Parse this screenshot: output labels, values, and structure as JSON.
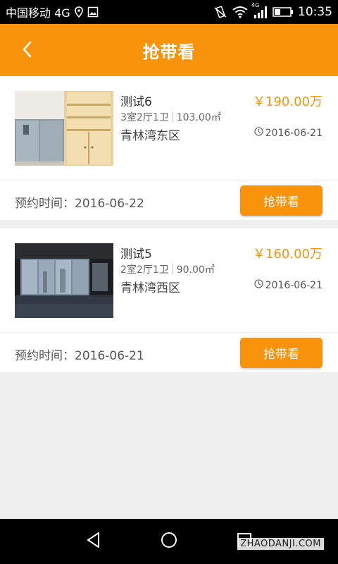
{
  "status_bar": {
    "carrier": "中国移动 4G",
    "network_badge": "4G",
    "time": "10:35"
  },
  "header": {
    "title": "抢带看",
    "back_icon": "chevron-left-icon"
  },
  "listings": [
    {
      "name": "测试6",
      "price": "￥190.00万",
      "layout": "3室2厅1卫",
      "area": "103.00㎡",
      "district": "青林湾东区",
      "date": "2016-06-21",
      "appointment": "预约时间：2016-06-22",
      "button": "抢带看"
    },
    {
      "name": "测试5",
      "price": "￥160.00万",
      "layout": "2室2厅1卫",
      "area": "90.00㎡",
      "district": "青林湾西区",
      "date": "2016-06-21",
      "appointment": "预约时间：2016-06-21",
      "button": "抢带看"
    }
  ],
  "watermark": "ZHAODANJI.COM",
  "colors": {
    "accent": "#f9930b",
    "background": "#f0f0f0"
  }
}
